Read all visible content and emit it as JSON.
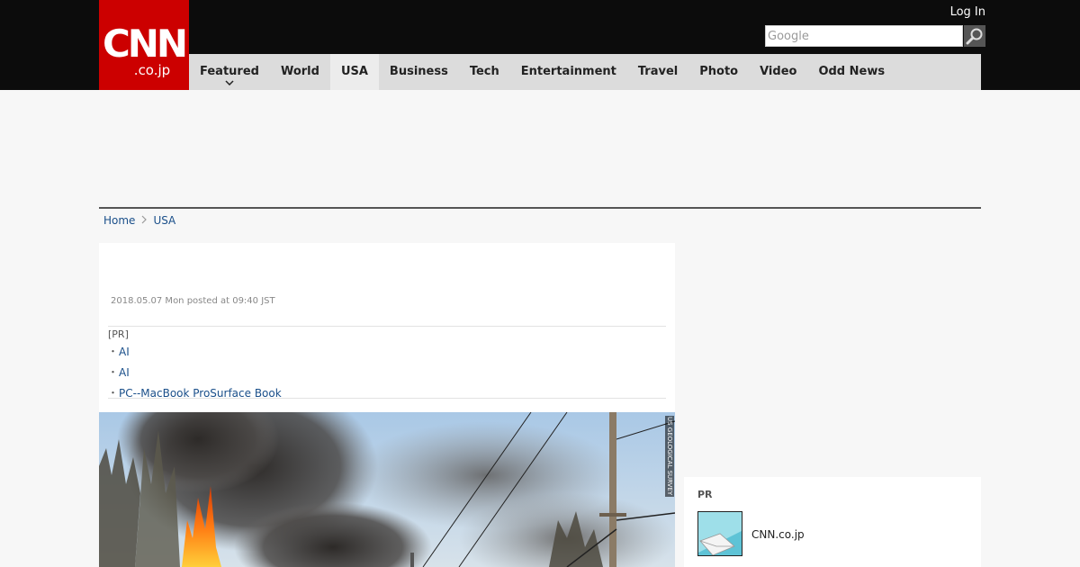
{
  "header": {
    "logo": {
      "top": "CNN",
      "bottom": ".co.jp"
    },
    "login_label": "Log In",
    "search": {
      "placeholder": "Google",
      "button_icon": "search-icon"
    }
  },
  "nav": {
    "items": [
      {
        "label": "Featured",
        "has_dropdown": true
      },
      {
        "label": "World"
      },
      {
        "label": "USA",
        "active": true
      },
      {
        "label": "Business"
      },
      {
        "label": "Tech"
      },
      {
        "label": "Entertainment"
      },
      {
        "label": "Travel"
      },
      {
        "label": "Photo"
      },
      {
        "label": "Video"
      },
      {
        "label": "Odd News"
      }
    ]
  },
  "breadcrumb": {
    "home": "Home",
    "current": "USA"
  },
  "article": {
    "date": "2018.05.07 Mon posted at 09:40 JST",
    "pr": {
      "label": "[PR]",
      "items": [
        "AI",
        "AI",
        "PC--MacBook ProSurface Book"
      ]
    },
    "photo": {
      "credit": "US GEOLOGICAL SURVEY"
    }
  },
  "sidebar": {
    "pr_label": "PR",
    "pr_item_text": "CNN.co.jp"
  },
  "colors": {
    "brand_red": "#cc0000",
    "topbar": "#0c0c0c",
    "nav_bg": "#dcdcdc",
    "link": "#1a4f8a"
  }
}
